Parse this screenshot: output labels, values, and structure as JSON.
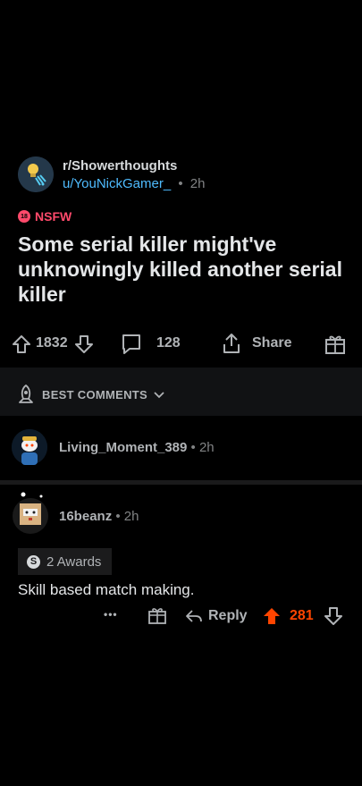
{
  "post": {
    "subreddit": "r/Showerthoughts",
    "author": "u/YouNickGamer_",
    "separator": "•",
    "age": "2h",
    "nsfw_label": "NSFW",
    "nsfw_badge": "18",
    "title": "Some serial killer might've unknowingly killed another serial killer",
    "upvotes": "1832",
    "comments": "128",
    "share_label": "Share"
  },
  "sort": {
    "label": "BEST COMMENTS"
  },
  "comments": [
    {
      "author": "Living_Moment_389",
      "age": "• 2h"
    },
    {
      "author": "16beanz",
      "age": "• 2h",
      "awards": "2 Awards",
      "award_coin": "S",
      "body": "Skill based match making.",
      "more": "•••",
      "reply_label": "Reply",
      "score": "281"
    }
  ],
  "colors": {
    "accent_upvote": "#ff4500",
    "link": "#4fbcff",
    "nsfw": "#ff4a6b"
  }
}
